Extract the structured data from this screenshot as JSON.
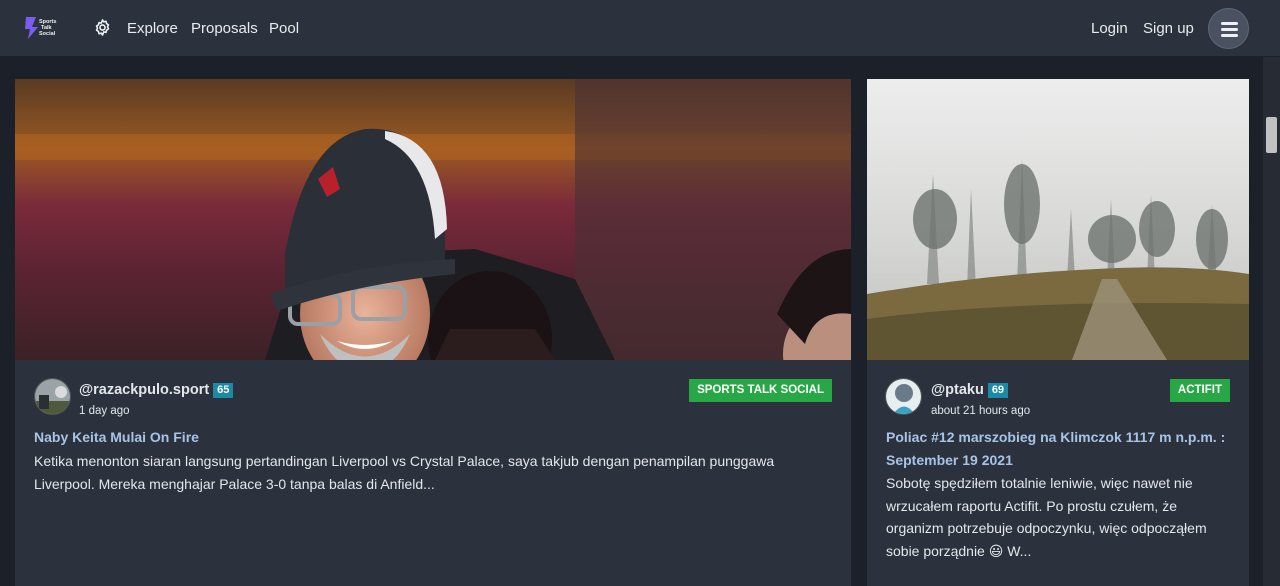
{
  "nav": {
    "logo_text": "Sports Talk Social",
    "links": [
      "Explore",
      "Proposals",
      "Pool"
    ],
    "login": "Login",
    "signup": "Sign up",
    "icons": {
      "settings": "gear-icon",
      "menu": "hamburger-icon"
    }
  },
  "posts": [
    {
      "author": "@razackpulo.sport",
      "reputation": "65",
      "time": "1 day ago",
      "community": "SPORTS TALK SOCIAL",
      "title": "Naby Keita Mulai On Fire",
      "excerpt": "Ketika menonton siaran langsung pertandingan Liverpool vs Crystal Palace, saya takjub dengan penampilan punggawa Liverpool. Mereka menghajar Palace 3-0 tanpa balas di Anfield..."
    },
    {
      "author": "@ptaku",
      "reputation": "69",
      "time": "about 21 hours ago",
      "community": "ACTIFIT",
      "title": "Poliac #12 marszobieg na Klimczok 1117 m n.p.m. : September 19 2021",
      "excerpt": "Sobotę spędziłem totalnie leniwie, więc nawet nie wrzucałem raportu Actifit. Po prostu czułem, że organizm potrzebuje odpoczynku, więc odpocząłem sobie porządnie 😃 W..."
    }
  ],
  "colors": {
    "accent_green": "#27a745",
    "reputation_badge": "#1a8aa6",
    "title_blue": "#a8c3e6"
  }
}
